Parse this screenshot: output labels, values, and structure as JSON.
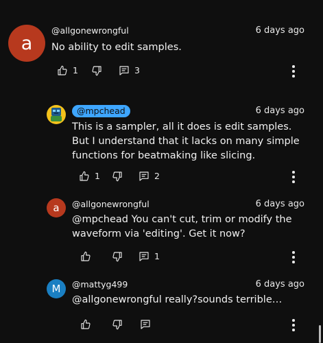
{
  "comments": [
    {
      "avatar_letter": "a",
      "avatar_color": "#b7391e",
      "author": "@allgonewrongful",
      "time": "6 days ago",
      "text": "No ability to edit samples.",
      "likes": "1",
      "replies": "3"
    },
    {
      "avatar_letter": "",
      "avatar_color": "#f4c21b",
      "avatar_icon": "character-avatar-icon",
      "author": "@mpchead",
      "author_highlight_color": "#3ea6ff",
      "time": "6 days ago",
      "text": "This is a sampler, all it does is edit samples. But I understand that it lacks on many simple functions for beatmaking like slicing.",
      "likes": "1",
      "replies": "2"
    },
    {
      "avatar_letter": "a",
      "avatar_color": "#b7391e",
      "author": "@allgonewrongful",
      "time": "6 days ago",
      "text": "@mpchead You can't cut, trim or modify the waveform via 'editing'. Get it now?",
      "likes": "",
      "replies": "1"
    },
    {
      "avatar_letter": "M",
      "avatar_color": "#1a7fc2",
      "author": "@mattyg499",
      "time": "6 days ago",
      "text": "@allgonewrongful really?sounds terrible…",
      "likes": "",
      "replies": ""
    }
  ],
  "icons": {
    "like": "thumb-up-icon",
    "dislike": "thumb-down-icon",
    "reply": "comment-icon",
    "more": "more-vert-icon"
  }
}
